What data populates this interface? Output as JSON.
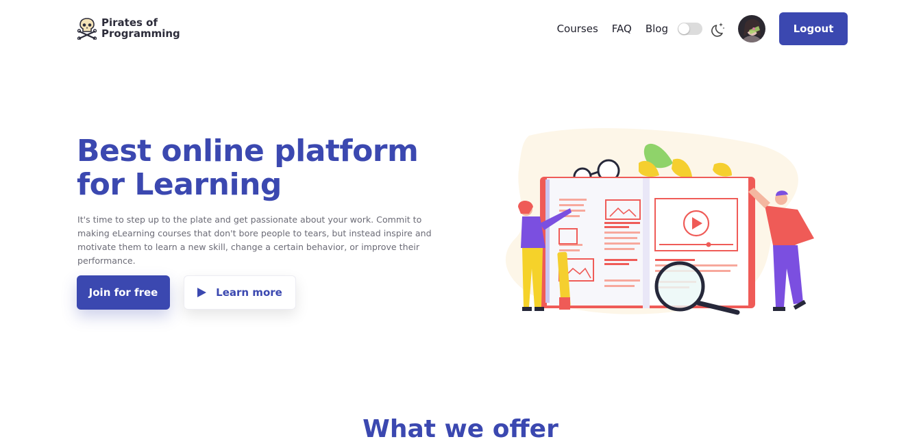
{
  "brand": {
    "line1": "Pirates of",
    "line2": "Programming",
    "logo_icon": "skull-crossbones-icon"
  },
  "nav": {
    "links": [
      "Courses",
      "FAQ",
      "Blog"
    ],
    "theme_toggle": "off",
    "theme_icon": "moon-stars-icon",
    "logout_label": "Logout"
  },
  "hero": {
    "title_line1": "Best online platform",
    "title_line2": "for Learning",
    "description": "It's time to step up to the plate and get passionate about your work. Commit to making eLearning courses that don't bore people to tears, but instead inspire and motivate them to learn a new skill, change a certain behavior, or improve their performance.",
    "join_label": "Join for free",
    "learn_label": "Learn more",
    "illustration": "open-book-learning-illustration"
  },
  "offer": {
    "title": "What we offer"
  },
  "colors": {
    "primary": "#3b48b0",
    "accent_red": "#ef5b57",
    "text": "#1f1f2b",
    "muted": "#6b6b76"
  }
}
